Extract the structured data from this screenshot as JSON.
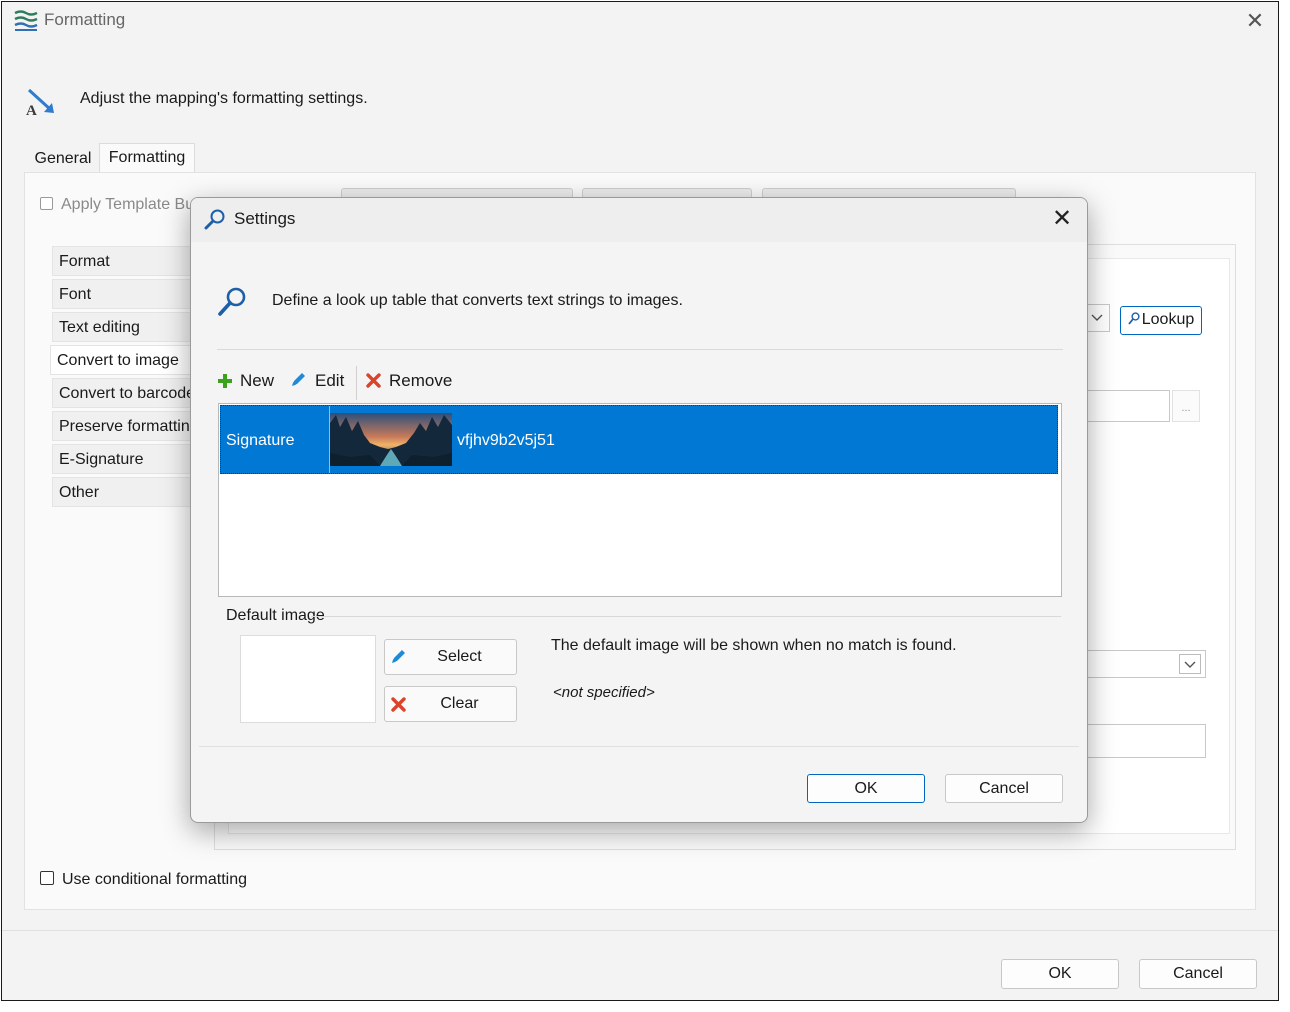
{
  "window": {
    "title": "Formatting",
    "header_text": "Adjust the mapping's formatting settings.",
    "tabs": [
      {
        "label": "General"
      },
      {
        "label": "Formatting"
      }
    ],
    "apply_template_label": "Apply Template Bu",
    "nav_items": [
      {
        "label": "Format"
      },
      {
        "label": "Font"
      },
      {
        "label": "Text editing"
      },
      {
        "label": "Convert to image"
      },
      {
        "label": "Convert to barcode"
      },
      {
        "label": "Preserve formatting"
      },
      {
        "label": "E-Signature"
      },
      {
        "label": "Other"
      }
    ],
    "lookup_button": "Lookup",
    "ellipsis_button": "...",
    "use_conditional_label": "Use conditional formatting",
    "ok_button": "OK",
    "cancel_button": "Cancel"
  },
  "dialog": {
    "title": "Settings",
    "description": "Define a look up table that converts text strings to images.",
    "toolbar": {
      "new_label": "New",
      "edit_label": "Edit",
      "remove_label": "Remove"
    },
    "rows": [
      {
        "text": "Signature",
        "code": "vfjhv9b2v5j51"
      }
    ],
    "default_image": {
      "label": "Default image",
      "select_button": "Select",
      "clear_button": "Clear",
      "info": "The default image will be shown when no match is found.",
      "value": "<not specified>"
    },
    "ok_button": "OK",
    "cancel_button": "Cancel"
  },
  "colors": {
    "accent": "#0078d4",
    "add_green": "#3aa31b",
    "remove_red": "#d9442b",
    "edit_blue": "#1f8ad6"
  }
}
